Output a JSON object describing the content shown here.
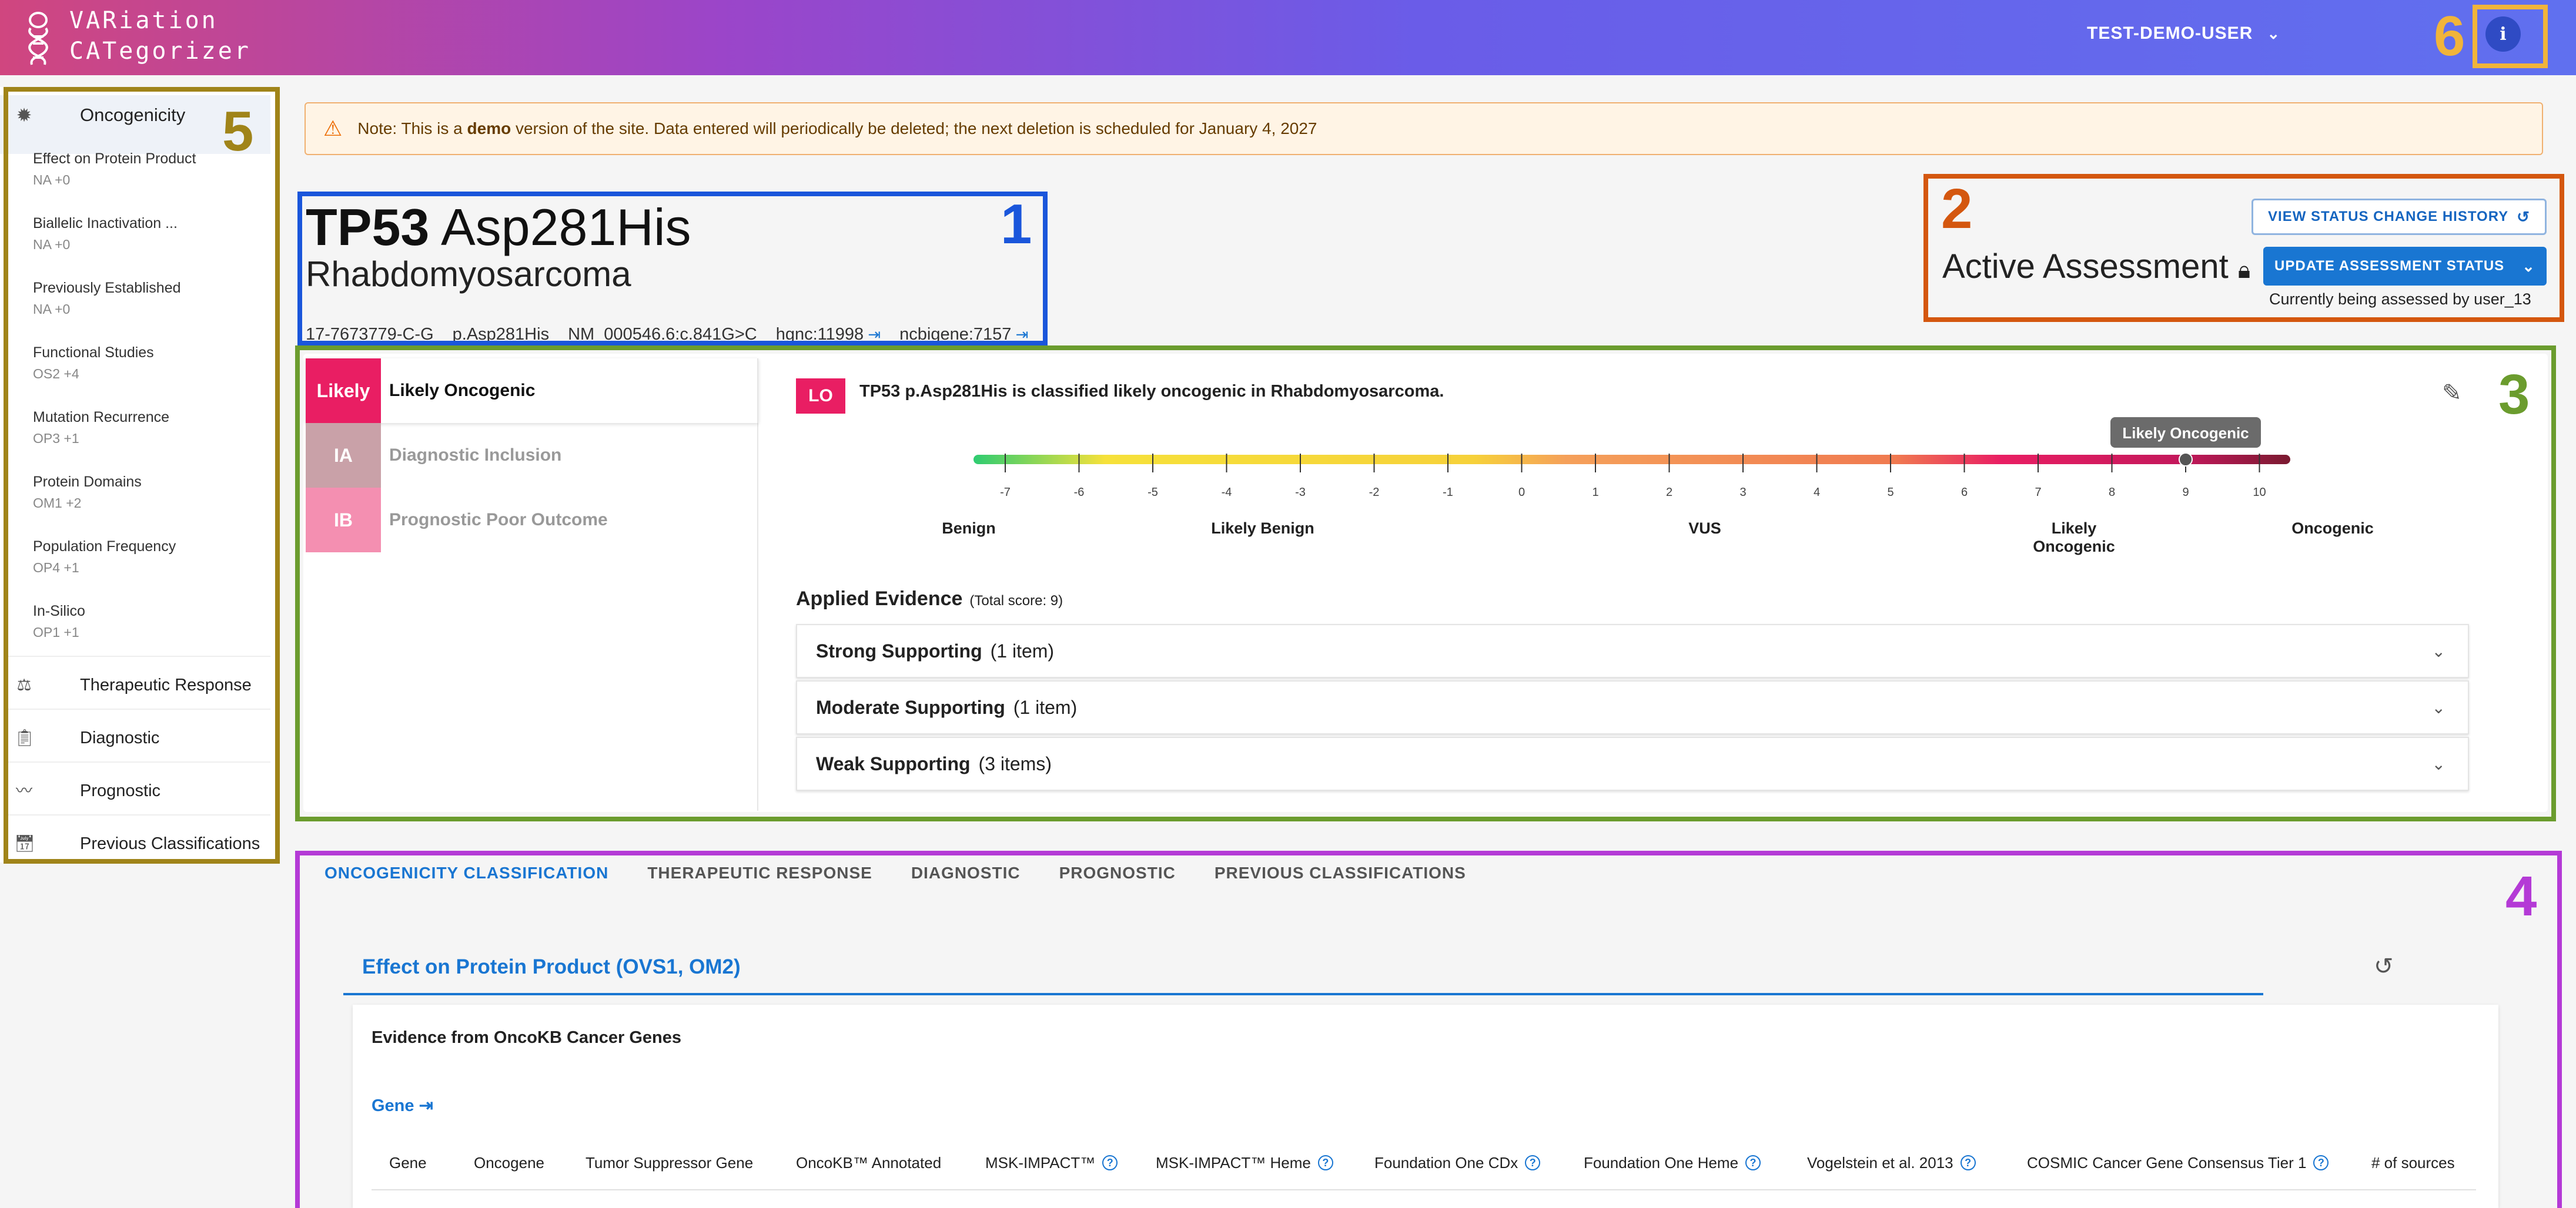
{
  "header": {
    "logo_line1": "VARiation",
    "logo_line2": "CATegorizer",
    "user": "TEST-DEMO-USER",
    "info_glyph": "i",
    "user_chevron_icon": "chevron-down-icon"
  },
  "annotation_numbers": [
    "1",
    "2",
    "3",
    "4",
    "5",
    "6"
  ],
  "sidebar": {
    "head_label": "Oncogenicity",
    "sub_items": [
      {
        "title": "Effect on Protein Product",
        "value": "NA +0"
      },
      {
        "title": "Biallelic Inactivation ...",
        "value": "NA +0"
      },
      {
        "title": "Previously Established",
        "value": "NA +0"
      },
      {
        "title": "Functional Studies",
        "value": "OS2 +4"
      },
      {
        "title": "Mutation Recurrence",
        "value": "OP3 +1"
      },
      {
        "title": "Protein Domains",
        "value": "OM1 +2"
      },
      {
        "title": "Population Frequency",
        "value": "OP4 +1"
      },
      {
        "title": "In-Silico",
        "value": "OP1 +1"
      }
    ],
    "sections": [
      {
        "label": "Therapeutic Response",
        "icon": "scale-icon"
      },
      {
        "label": "Diagnostic",
        "icon": "clipboard-icon"
      },
      {
        "label": "Prognostic",
        "icon": "pulse-icon"
      },
      {
        "label": "Previous Classifications",
        "icon": "calendar-history-icon"
      }
    ]
  },
  "banner": {
    "prefix": "Note: This is a ",
    "bold": "demo",
    "suffix": " version of the site. Data entered will periodically be deleted; the next deletion is scheduled for January 4, 2027"
  },
  "variant": {
    "gene": "TP53",
    "protein": "Asp281His",
    "disease": "Rhabdomyosarcoma",
    "genomic": "17-7673779-C-G",
    "pchange": "p.Asp281His",
    "cchange": "NM_000546.6:c.841G>C",
    "hgnc": "hgnc:11998",
    "ncbigene": "ncbigene:7157"
  },
  "assessment": {
    "history_button": "VIEW STATUS CHANGE HISTORY",
    "update_button": "UPDATE ASSESSMENT STATUS",
    "status": "Active Assessment",
    "assessed_by": "Currently being assessed by user_13"
  },
  "tiers": [
    {
      "tag": "Likely",
      "label": "Likely Oncogenic",
      "color": "#e91e63",
      "label_color": "#111"
    },
    {
      "tag": "IA",
      "label": "Diagnostic Inclusion",
      "color": "#c9a1a8",
      "label_color": "#999"
    },
    {
      "tag": "IB",
      "label": "Prognostic Poor Outcome",
      "color": "#f48fb1",
      "label_color": "#999"
    }
  ],
  "classification": {
    "badge": "LO",
    "text": "TP53 p.Asp281His is classified likely oncogenic in Rhabdomyosarcoma.",
    "tooltip": "Likely Oncogenic",
    "score": 9,
    "ticks": [
      "-7",
      "-6",
      "-5",
      "-4",
      "-3",
      "-2",
      "-1",
      "0",
      "1",
      "2",
      "3",
      "4",
      "5",
      "6",
      "7",
      "8",
      "9",
      "10"
    ],
    "categories": [
      "Benign",
      "Likely Benign",
      "VUS",
      "Likely Oncogenic",
      "Oncogenic"
    ]
  },
  "evidence": {
    "title": "Applied Evidence",
    "total": "(Total score: 9)",
    "items": [
      {
        "name": "Strong Supporting",
        "count": "(1 item)"
      },
      {
        "name": "Moderate Supporting",
        "count": "(1 item)"
      },
      {
        "name": "Weak Supporting",
        "count": "(3 items)"
      }
    ]
  },
  "tabs": [
    "ONCOGENICITY CLASSIFICATION",
    "THERAPEUTIC RESPONSE",
    "DIAGNOSTIC",
    "PROGNOSTIC",
    "PREVIOUS CLASSIFICATIONS"
  ],
  "section": {
    "title": "Effect on Protein Product (OVS1, OM2)",
    "card_title": "Evidence from OncoKB Cancer Genes",
    "gene_link": "Gene",
    "columns": [
      {
        "label": "Gene",
        "help": false
      },
      {
        "label": "Oncogene",
        "help": false
      },
      {
        "label": "Tumor Suppressor Gene",
        "help": false
      },
      {
        "label": "OncoKB™ Annotated",
        "help": false
      },
      {
        "label": "MSK-IMPACT™",
        "help": true
      },
      {
        "label": "MSK-IMPACT™ Heme",
        "help": true
      },
      {
        "label": "Foundation One CDx",
        "help": true
      },
      {
        "label": "Foundation One Heme",
        "help": true
      },
      {
        "label": "Vogelstein et al. 2013",
        "help": true
      },
      {
        "label": "COSMIC Cancer Gene Consensus Tier 1",
        "help": true
      },
      {
        "label": "# of sources",
        "help": false
      }
    ]
  },
  "colors": {
    "annotation_1": "#1a56db",
    "annotation_2": "#d4570f",
    "annotation_3": "#6b9c2e",
    "annotation_4": "#b43ad6",
    "annotation_5": "#a08419",
    "annotation_6": "#f1b43a",
    "accent": "#1976d2"
  }
}
